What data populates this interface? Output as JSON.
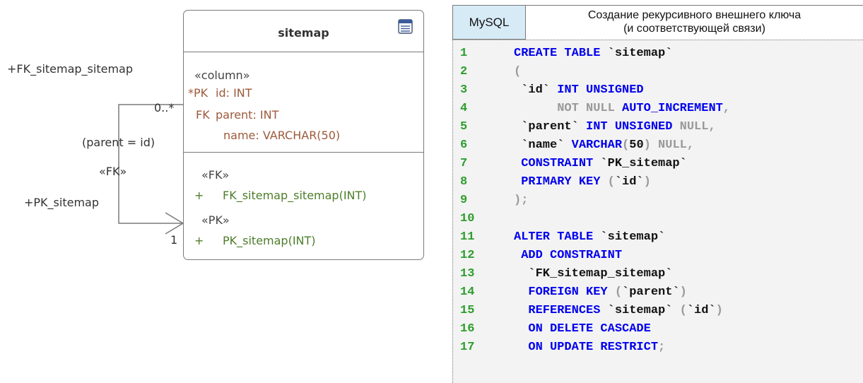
{
  "diagram": {
    "table_name": "sitemap",
    "icon": "table-icon",
    "column_stereotype": "«column»",
    "columns": [
      {
        "marker": "*PK",
        "text": "id: INT"
      },
      {
        "marker": "FK",
        "text": "parent: INT"
      },
      {
        "marker": "",
        "text": "name: VARCHAR(50)"
      }
    ],
    "fk_stereotype": "«FK»",
    "fk_op": {
      "sign": "+",
      "text": "FK_sitemap_sitemap(INT)"
    },
    "pk_stereotype": "«PK»",
    "pk_op": {
      "sign": "+",
      "text": "PK_sitemap(INT)"
    },
    "relation": {
      "source_role": "+FK_sitemap_sitemap",
      "target_role": "+PK_sitemap",
      "source_multiplicity": "0..*",
      "target_multiplicity": "1",
      "condition": "(parent = id)",
      "stereotype": "«FK»"
    },
    "colors": {
      "border": "#7a7a7a",
      "brown": "#9c5a3c",
      "green": "#4d7d2a"
    }
  },
  "listing": {
    "language": "MySQL",
    "caption_line1": "Создание рекурсивного внешнего ключа",
    "caption_line2": "(и соответствующей связи)",
    "colors": {
      "tab": "#d7ebf7",
      "keyword": "#0000ee",
      "line_number": "#2e9e2e",
      "punct": "#9a9a9a",
      "background": "#f3f3f3"
    },
    "lines": [
      {
        "n": "1",
        "tokens": [
          {
            "t": "CREATE TABLE",
            "c": "kw"
          },
          {
            "t": " `sitemap`",
            "c": "tx"
          }
        ]
      },
      {
        "n": "2",
        "tokens": [
          {
            "t": "(",
            "c": "gr"
          }
        ]
      },
      {
        "n": "3",
        "tokens": [
          {
            "t": " `id`",
            "c": "tx"
          },
          {
            "t": " INT UNSIGNED",
            "c": "kw"
          }
        ]
      },
      {
        "n": "4",
        "tokens": [
          {
            "t": "      NOT NULL",
            "c": "gr"
          },
          {
            "t": " AUTO_INCREMENT",
            "c": "kw"
          },
          {
            "t": ",",
            "c": "gr"
          }
        ]
      },
      {
        "n": "5",
        "tokens": [
          {
            "t": " `parent`",
            "c": "tx"
          },
          {
            "t": " INT UNSIGNED",
            "c": "kw"
          },
          {
            "t": " NULL,",
            "c": "gr"
          }
        ]
      },
      {
        "n": "6",
        "tokens": [
          {
            "t": " `name`",
            "c": "tx"
          },
          {
            "t": " VARCHAR",
            "c": "kw"
          },
          {
            "t": "(",
            "c": "gr"
          },
          {
            "t": "50",
            "c": "tx"
          },
          {
            "t": ")",
            "c": "gr"
          },
          {
            "t": " NULL,",
            "c": "gr"
          }
        ]
      },
      {
        "n": "7",
        "tokens": [
          {
            "t": " CONSTRAINT",
            "c": "kw"
          },
          {
            "t": " `PK_sitemap`",
            "c": "tx"
          }
        ]
      },
      {
        "n": "8",
        "tokens": [
          {
            "t": " PRIMARY KEY",
            "c": "kw"
          },
          {
            "t": " (",
            "c": "gr"
          },
          {
            "t": "`id`",
            "c": "tx"
          },
          {
            "t": ")",
            "c": "gr"
          }
        ]
      },
      {
        "n": "9",
        "tokens": [
          {
            "t": ");",
            "c": "gr"
          }
        ]
      },
      {
        "n": "10",
        "tokens": []
      },
      {
        "n": "11",
        "tokens": [
          {
            "t": "ALTER TABLE",
            "c": "kw"
          },
          {
            "t": " `sitemap`",
            "c": "tx"
          }
        ]
      },
      {
        "n": "12",
        "tokens": [
          {
            "t": " ADD CONSTRAINT",
            "c": "kw"
          }
        ]
      },
      {
        "n": "13",
        "tokens": [
          {
            "t": "  `FK_sitemap_sitemap`",
            "c": "tx"
          }
        ]
      },
      {
        "n": "14",
        "tokens": [
          {
            "t": "  FOREIGN KEY",
            "c": "kw"
          },
          {
            "t": " (",
            "c": "gr"
          },
          {
            "t": "`parent`",
            "c": "tx"
          },
          {
            "t": ")",
            "c": "gr"
          }
        ]
      },
      {
        "n": "15",
        "tokens": [
          {
            "t": "  REFERENCES",
            "c": "kw"
          },
          {
            "t": " `sitemap`",
            "c": "tx"
          },
          {
            "t": " (",
            "c": "gr"
          },
          {
            "t": "`id`",
            "c": "tx"
          },
          {
            "t": ")",
            "c": "gr"
          }
        ]
      },
      {
        "n": "16",
        "tokens": [
          {
            "t": "  ON DELETE CASCADE",
            "c": "kw"
          }
        ]
      },
      {
        "n": "17",
        "tokens": [
          {
            "t": "  ON UPDATE RESTRICT",
            "c": "kw"
          },
          {
            "t": ";",
            "c": "gr"
          }
        ]
      }
    ]
  }
}
